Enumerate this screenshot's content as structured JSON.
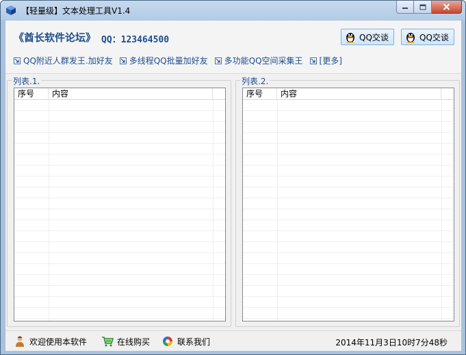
{
  "window": {
    "title": "【轻量级】文本处理工具V1.4",
    "buttons": {
      "minimize": "minimize-icon",
      "maximize": "maximize-icon",
      "close": "close-icon"
    }
  },
  "header": {
    "forum_title": "《酋长软件论坛》",
    "qq_number": "QQ：123464500",
    "qq_buttons": [
      {
        "label": "QQ交谈",
        "icon": "qq-penguin-icon"
      },
      {
        "label": "QQ交谈",
        "icon": "qq-penguin-icon"
      }
    ],
    "links": [
      {
        "label": "QQ附近人群发王.加好友"
      },
      {
        "label": "多线程QQ批量加好友"
      },
      {
        "label": "多功能QQ空间采集王"
      },
      {
        "label": "[更多]"
      }
    ]
  },
  "lists": [
    {
      "label": "列表.1.",
      "columns": [
        "序号",
        "内容",
        ""
      ]
    },
    {
      "label": "列表.2.",
      "columns": [
        "序号",
        "内容",
        ""
      ]
    }
  ],
  "statusbar": {
    "welcome": "欢迎使用本软件",
    "buy": "在线购买",
    "contact": "联系我们",
    "time": "2014年11月3日10时7分48秒"
  },
  "colors": {
    "title_bar": "#b3cbe5",
    "link_blue": "#1c4d8c",
    "close_red": "#c8462f"
  }
}
